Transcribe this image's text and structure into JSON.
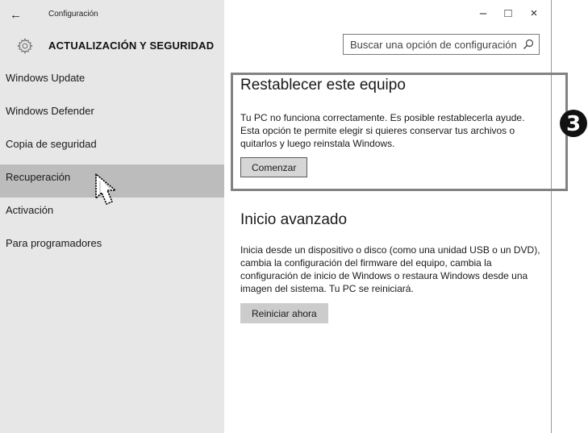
{
  "titlebar": {
    "back_icon": "←",
    "title": "Configuración",
    "minimize": "–",
    "maximize": "□",
    "close": "×"
  },
  "header": {
    "section_title": "ACTUALIZACIÓN Y SEGURIDAD",
    "search_placeholder": "Buscar una opción de configuración"
  },
  "sidebar": {
    "items": [
      {
        "label": "Windows Update",
        "selected": false
      },
      {
        "label": "Windows Defender",
        "selected": false
      },
      {
        "label": "Copia de seguridad",
        "selected": false
      },
      {
        "label": "Recuperación",
        "selected": true
      },
      {
        "label": "Activación",
        "selected": false
      },
      {
        "label": "Para programadores",
        "selected": false
      }
    ]
  },
  "reset": {
    "heading": "Restablecer este equipo",
    "body": "Tu PC no funciona correctamente. Es posible restablecerla ayude. Esta opción te permite elegir si quieres conservar tus archivos o quitarlos y luego reinstala Windows.",
    "button": "Comenzar"
  },
  "advanced": {
    "heading": "Inicio avanzado",
    "body": "Inicia desde un dispositivo o disco (como una unidad USB o un DVD), cambia la configuración del firmware del equipo, cambia la configuración de inicio de Windows o restaura Windows desde una imagen del sistema. Tu PC se reiniciará.",
    "button": "Reiniciar ahora"
  },
  "annotation": {
    "step_number": "3"
  },
  "colors": {
    "sidebar_bg": "#e7e7e7",
    "selected_bg": "#bcbcbc",
    "button_bg": "#cccccc",
    "highlight_border": "#828282"
  }
}
